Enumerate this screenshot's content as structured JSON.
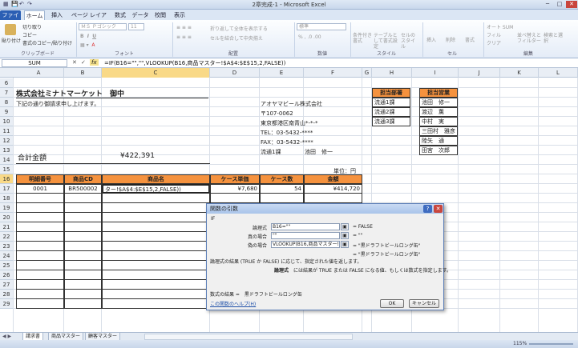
{
  "window": {
    "title": "2章完成-1 - Microsoft Excel",
    "minimize": "─",
    "restore": "□",
    "close": "✕"
  },
  "quick_access": {
    "save": "💾",
    "undo": "↶",
    "redo": "↷"
  },
  "tabs": [
    "ファイル",
    "ホーム",
    "挿入",
    "ページ レイアウト",
    "数式",
    "データ",
    "校閲",
    "表示"
  ],
  "ribbon": {
    "paste": "貼り付け",
    "cut": "切り取り",
    "copy": "コピー",
    "format_copy": "書式のコピー/貼り付け",
    "clipboard": "クリップボード",
    "font_name": "ＭＳ Ｐゴシック",
    "font_size": "11",
    "font": "フォント",
    "wrap": "折り返して全体を表示する",
    "merge": "セルを結合して中央揃え",
    "align": "配置",
    "number_format": "標準",
    "number": "数値",
    "cond_format": "条件付き書式",
    "table_format": "テーブルとして書式設定",
    "cell_style": "セルのスタイル",
    "style": "スタイル",
    "insert": "挿入",
    "delete": "削除",
    "format": "書式",
    "cells": "セル",
    "autosum": "オート SUM",
    "fill": "フィル",
    "clear": "クリア",
    "sort_filter": "並べ替えとフィルター",
    "find_select": "検索と選択",
    "editing": "編集"
  },
  "formula_bar": {
    "name_box": "SUM",
    "cancel": "✕",
    "enter": "✓",
    "fx": "fx",
    "formula": "=IF(B16=\"\",\"\",VLOOKUP(B16,商品マスター!$A$4:$E$15,2,FALSE))"
  },
  "columns": [
    "A",
    "B",
    "C",
    "D",
    "E",
    "F",
    "G",
    "H",
    "I",
    "J",
    "K",
    "L",
    "M"
  ],
  "rows": [
    "6",
    "7",
    "8",
    "9",
    "10",
    "11",
    "12",
    "13",
    "14",
    "15",
    "16",
    "17",
    "18",
    "19",
    "20",
    "21",
    "22",
    "23",
    "24",
    "25",
    "26",
    "27",
    "28",
    "29"
  ],
  "sheet": {
    "company_title": "株式会社ミナトマーケット　御中",
    "intro": "下記の通り御請求申し上げます。",
    "issuer_name": "アオヤマビール株式会社",
    "issuer_zip": "〒107-0062",
    "issuer_addr": "東京都港区南青山*-*-*",
    "issuer_tel": "TEL：03-5432-****",
    "issuer_fax": "FAX：03-5432-****",
    "issuer_dept": "流通1課",
    "issuer_person": "池田　修一",
    "total_label": "合計金額",
    "total_value": "¥422,391",
    "unit": "単位：円",
    "dept_header": "担当部署",
    "depts": [
      "流通1課",
      "流通2課",
      "流通3課"
    ],
    "staff_header": "担当営業",
    "staff": [
      "池田　修一",
      "渡辺　薫",
      "中村　実",
      "三田村　雅彦",
      "陸矢　通",
      "田宮　次郎"
    ],
    "table_headers": [
      "明細番号",
      "商品CD",
      "商品名",
      "ケース単価",
      "ケース数",
      "金額"
    ],
    "row16": {
      "no": "0001",
      "code": "BR500002",
      "name": "ター!$A$4:$E$15,2,FALSE))",
      "price": "¥7,680",
      "qty": "54",
      "amount": "¥414,720"
    }
  },
  "sheet_tabs": [
    "請求書",
    "商品マスター",
    "顧客マスター"
  ],
  "status": {
    "zoom": "115%"
  },
  "dialog": {
    "title": "関数の引数",
    "func": "IF",
    "labels": [
      "論理式",
      "真の場合",
      "偽の場合"
    ],
    "values": [
      "B16=\"\"",
      "\"\"",
      "VLOOKUP(B16,商品マスター!$A$4"
    ],
    "results": [
      "= FALSE",
      "= \"\"",
      "= \"黒ドラフトビールロング缶\""
    ],
    "overall_result": "= \"黒ドラフトビールロング缶\"",
    "desc1": "論理式の結果 (TRUE か FALSE) に応じて、指定された値を返します。",
    "desc2_label": "論理式",
    "desc2": "には結果が TRUE または FALSE になる値、もしくは数式を指定します。",
    "formula_result": "数式の結果 =　黒ドラフトビールロング缶",
    "help_link": "この関数のヘルプ(H)",
    "ok": "OK",
    "cancel": "キャンセル",
    "help_btn": "?",
    "close_btn": "✕"
  }
}
